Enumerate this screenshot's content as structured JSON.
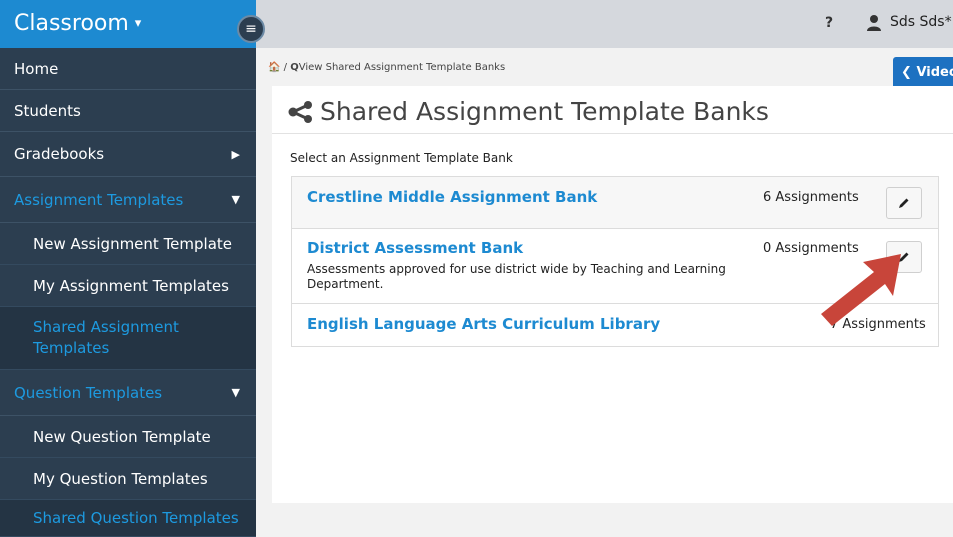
{
  "sidebar": {
    "brand": "Classroom",
    "items": [
      {
        "label": "Home"
      },
      {
        "label": "Students"
      },
      {
        "label": "Gradebooks"
      },
      {
        "label": "Assignment Templates"
      },
      {
        "label": "New Assignment Template"
      },
      {
        "label": "My Assignment Templates"
      },
      {
        "label": "Shared Assignment Templates"
      },
      {
        "label": "Question Templates"
      },
      {
        "label": "New Question Template"
      },
      {
        "label": "My Question Templates"
      },
      {
        "label": "Shared Question Templates"
      }
    ]
  },
  "header": {
    "help": "?",
    "user": "Sds Sds* -"
  },
  "breadcrumb": {
    "current": "View Shared Assignment Template Banks"
  },
  "video_button": "Video",
  "page": {
    "title": "Shared Assignment Template Banks",
    "select_label": "Select an Assignment Template Bank"
  },
  "banks": [
    {
      "name": "Crestline Middle Assignment Bank",
      "count": "6 Assignments",
      "description": ""
    },
    {
      "name": "District Assessment Bank",
      "count": "0 Assignments",
      "description": "Assessments approved for use district wide by Teaching and Learning Department."
    },
    {
      "name": "English Language Arts Curriculum Library",
      "count": "7 Assignments",
      "description": ""
    }
  ],
  "colors": {
    "brand_blue": "#1d8ad1",
    "sidebar_bg": "#2c3e50",
    "active_link": "#1d9ae0",
    "arrow": "#c8453a"
  }
}
